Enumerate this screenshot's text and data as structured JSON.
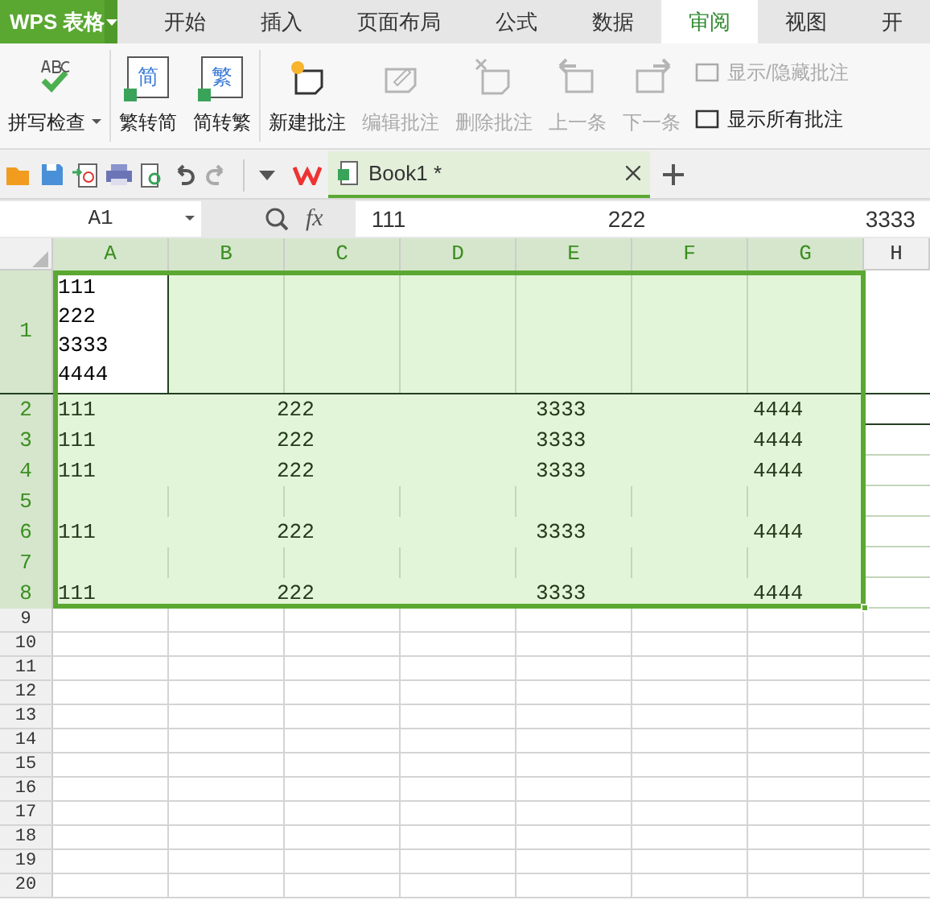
{
  "app": {
    "logo": "WPS 表格"
  },
  "menu_tabs": [
    {
      "label": "开始",
      "selected": false
    },
    {
      "label": "插入",
      "selected": false
    },
    {
      "label": "页面布局",
      "selected": false
    },
    {
      "label": "公式",
      "selected": false
    },
    {
      "label": "数据",
      "selected": false
    },
    {
      "label": "审阅",
      "selected": true
    },
    {
      "label": "视图",
      "selected": false
    },
    {
      "label": "开",
      "selected": false
    }
  ],
  "ribbon": {
    "large": [
      {
        "label": "拼写检查",
        "dropdown": true,
        "disabled": false
      },
      {
        "label": "繁转简",
        "icon_text": "简",
        "dropdown": false,
        "disabled": false
      },
      {
        "label": "简转繁",
        "icon_text": "繁",
        "dropdown": false,
        "disabled": false
      },
      {
        "label": "新建批注",
        "dropdown": false,
        "disabled": false
      },
      {
        "label": "编辑批注",
        "dropdown": false,
        "disabled": true
      },
      {
        "label": "删除批注",
        "dropdown": false,
        "disabled": true
      },
      {
        "label": "上一条",
        "dropdown": false,
        "disabled": true
      },
      {
        "label": "下一条",
        "dropdown": false,
        "disabled": true
      }
    ],
    "small": [
      {
        "label": "显示/隐藏批注",
        "disabled": true
      },
      {
        "label": "显示所有批注",
        "disabled": false
      }
    ]
  },
  "doc_tab": {
    "title": "Book1 *"
  },
  "formula_bar": {
    "name_box": "A1",
    "function_label": "fx",
    "value_parts": [
      "111",
      "222",
      "3333"
    ]
  },
  "columns": [
    {
      "label": "A",
      "selected": true
    },
    {
      "label": "B",
      "selected": true
    },
    {
      "label": "C",
      "selected": true
    },
    {
      "label": "D",
      "selected": true
    },
    {
      "label": "E",
      "selected": true
    },
    {
      "label": "F",
      "selected": true
    },
    {
      "label": "G",
      "selected": true
    },
    {
      "label": "H",
      "selected": false
    }
  ],
  "rows": [
    {
      "number": "1",
      "selected": true,
      "a1_lines": [
        "111",
        "222",
        "3333",
        "4444"
      ]
    },
    {
      "number": "2",
      "selected": true,
      "bordered": true,
      "cells": [
        "111",
        "222",
        "3333",
        "4444"
      ]
    },
    {
      "number": "3",
      "selected": true,
      "bordered": false,
      "cells": [
        "111",
        "222",
        "3333",
        "4444"
      ]
    },
    {
      "number": "4",
      "selected": true,
      "bordered": false,
      "cells": [
        "111",
        "222",
        "3333",
        "4444"
      ]
    },
    {
      "number": "5",
      "selected": true,
      "bordered": false,
      "cells": []
    },
    {
      "number": "6",
      "selected": true,
      "bordered": false,
      "cells": [
        "111",
        "222",
        "3333",
        "4444"
      ]
    },
    {
      "number": "7",
      "selected": true,
      "bordered": false,
      "cells": []
    },
    {
      "number": "8",
      "selected": true,
      "bordered": false,
      "cells": [
        "111",
        "222",
        "3333",
        "4444"
      ]
    },
    {
      "number": "9",
      "selected": false
    },
    {
      "number": "10",
      "selected": false
    },
    {
      "number": "11",
      "selected": false
    },
    {
      "number": "12",
      "selected": false
    },
    {
      "number": "13",
      "selected": false
    },
    {
      "number": "14",
      "selected": false
    },
    {
      "number": "15",
      "selected": false
    },
    {
      "number": "16",
      "selected": false
    },
    {
      "number": "17",
      "selected": false
    },
    {
      "number": "18",
      "selected": false
    },
    {
      "number": "19",
      "selected": false
    },
    {
      "number": "20",
      "selected": false
    }
  ]
}
